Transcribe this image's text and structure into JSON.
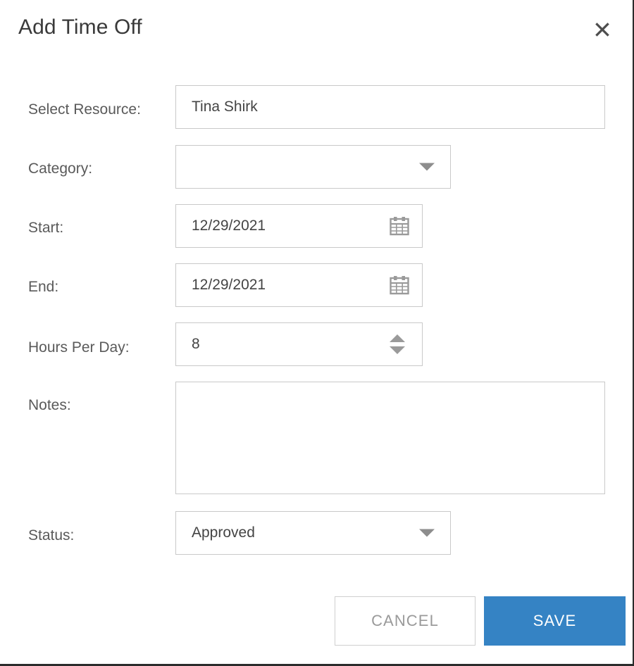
{
  "dialog": {
    "title": "Add Time Off",
    "close_icon": "close-icon"
  },
  "form": {
    "fields": [
      {
        "key": "resource",
        "label": "Select Resource:",
        "value": "Tina Shirk",
        "type": "text"
      },
      {
        "key": "category",
        "label": "Category:",
        "value": "",
        "type": "select",
        "icon": "chevron-down-icon"
      },
      {
        "key": "start",
        "label": "Start:",
        "value": "12/29/2021",
        "type": "date",
        "icon": "calendar-icon"
      },
      {
        "key": "end",
        "label": "End:",
        "value": "12/29/2021",
        "type": "date",
        "icon": "calendar-icon"
      },
      {
        "key": "hours",
        "label": "Hours Per Day:",
        "value": "8",
        "type": "number",
        "icon": "spinner-icon"
      },
      {
        "key": "notes",
        "label": "Notes:",
        "value": "",
        "type": "textarea"
      },
      {
        "key": "status",
        "label": "Status:",
        "value": "Approved",
        "type": "select",
        "icon": "chevron-down-icon"
      }
    ]
  },
  "footer": {
    "cancel_label": "CANCEL",
    "save_label": "SAVE"
  },
  "colors": {
    "accent": "#3583c4",
    "border": "#c9c9c9",
    "label_text": "#5a5a5a",
    "value_text": "#444444",
    "cancel_text": "#9a9a9a",
    "title_text": "#3a3a3a",
    "icon_gray": "#9a9a9a"
  }
}
